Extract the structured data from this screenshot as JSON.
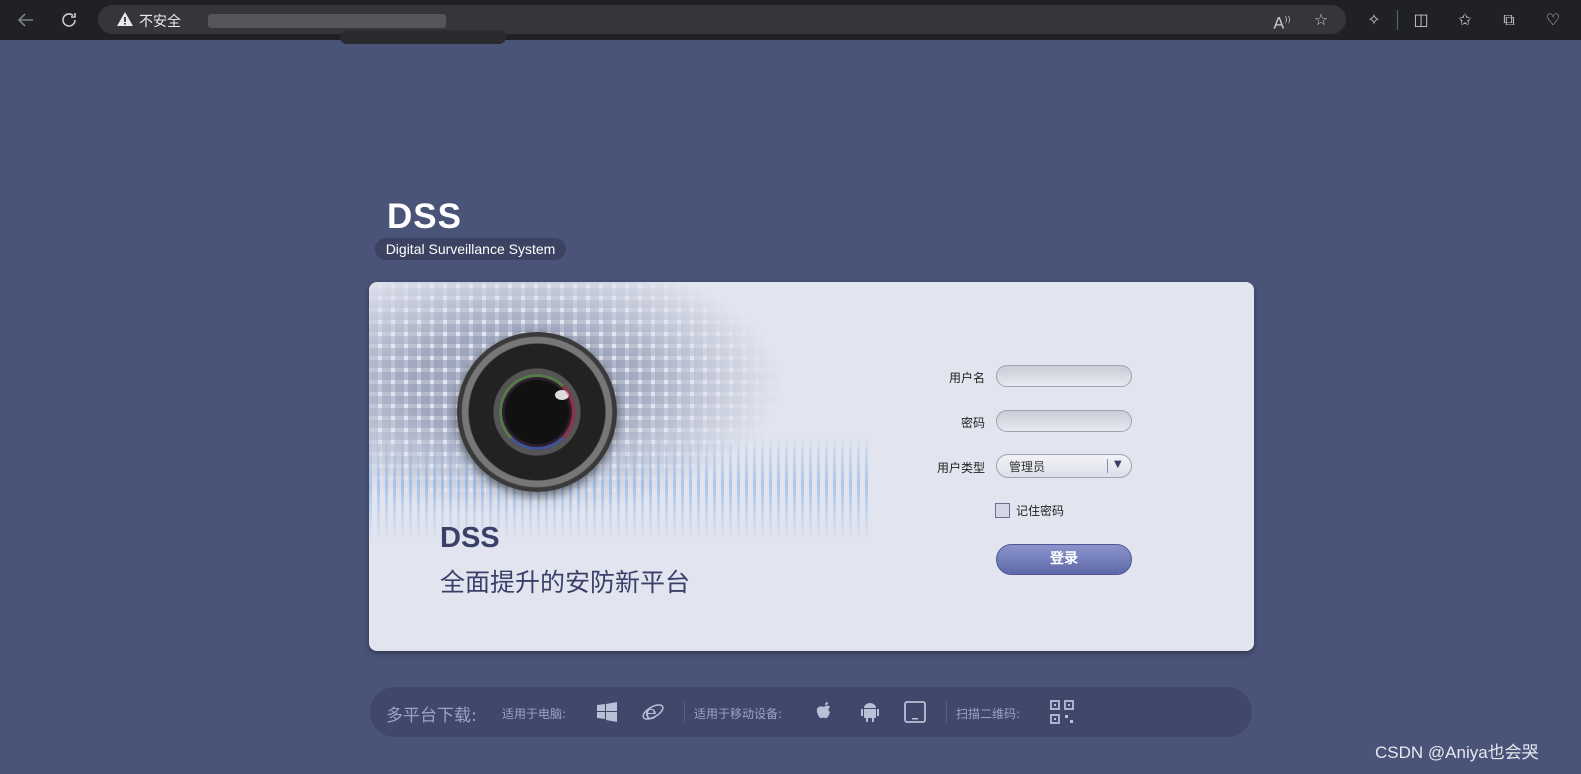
{
  "browser": {
    "security_text": "不安全",
    "icons": [
      "back-icon",
      "refresh-icon",
      "warning-icon",
      "read-aloud-icon",
      "favorite-star-icon",
      "extensions-icon",
      "split-screen-icon",
      "favorites-icon",
      "collections-icon",
      "health-icon"
    ]
  },
  "brand": {
    "title": "DSS",
    "subtitle": "Digital Surveillance System"
  },
  "hero": {
    "title": "DSS",
    "subtitle": "全面提升的安防新平台"
  },
  "login_form": {
    "username_label": "用户名",
    "username_value": "",
    "password_label": "密码",
    "password_value": "",
    "user_type_label": "用户类型",
    "user_type_value": "管理员",
    "remember_label": "记住密码",
    "login_button": "登录"
  },
  "downloads": {
    "title": "多平台下载:",
    "pc_label": "适用于电脑:",
    "mobile_label": "适用于移动设备:",
    "qr_label": "扫描二维码:",
    "icons": [
      "windows-icon",
      "ie-icon",
      "apple-icon",
      "android-icon",
      "tablet-icon",
      "qr-code-icon"
    ]
  },
  "watermark": "CSDN @Aniya也会哭"
}
